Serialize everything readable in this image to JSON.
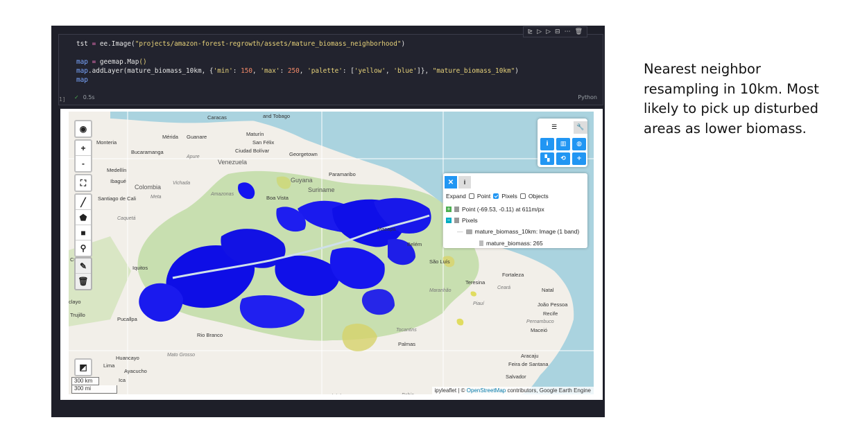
{
  "cell": {
    "toolbar_icons": [
      "run-by-line-icon",
      "run-above-icon",
      "run-below-icon",
      "split-cell-icon",
      "more-icon",
      "delete-icon"
    ],
    "toolbar_glyphs": [
      "⊵",
      "▷",
      "▷",
      "⊟",
      "⋯",
      "🗑"
    ],
    "code_lines": [
      {
        "parts": [
          [
            "",
            "tst "
          ],
          [
            "pink",
            "="
          ],
          [
            "",
            " ee.Image("
          ],
          [
            "str",
            "\"projects/amazon-forest-regrowth/assets/mature_biomass_neighborhood\""
          ],
          [
            "",
            ")"
          ]
        ]
      },
      {
        "parts": []
      },
      {
        "parts": [
          [
            "kw-var",
            "map"
          ],
          [
            "",
            " "
          ],
          [
            "pink",
            "="
          ],
          [
            "",
            " geemap.Map"
          ],
          [
            "str",
            "()"
          ]
        ]
      },
      {
        "parts": [
          [
            "kw-var",
            "map"
          ],
          [
            "",
            ".addLayer(mature_biomass_10km, {"
          ],
          [
            "str",
            "'min'"
          ],
          [
            "",
            ": "
          ],
          [
            "num",
            "150"
          ],
          [
            "",
            ", "
          ],
          [
            "str",
            "'max'"
          ],
          [
            "",
            ": "
          ],
          [
            "num",
            "250"
          ],
          [
            "",
            ", "
          ],
          [
            "str",
            "'palette'"
          ],
          [
            "",
            ": ["
          ],
          [
            "str",
            "'yellow'"
          ],
          [
            "",
            ", "
          ],
          [
            "str",
            "'blue'"
          ],
          [
            "",
            "]}, "
          ],
          [
            "str",
            "\"mature_biomass_10km\""
          ],
          [
            "",
            ")"
          ]
        ]
      },
      {
        "parts": [
          [
            "kw-var",
            "map"
          ]
        ]
      }
    ],
    "exec_count": "1]",
    "duration": "0.5s",
    "language": "Python"
  },
  "map": {
    "labels": [
      {
        "text": "Caracas",
        "cls": ""
      },
      {
        "text": "and Tobago",
        "cls": ""
      },
      {
        "text": "Mérida",
        "cls": ""
      },
      {
        "text": "Guanare",
        "cls": ""
      },
      {
        "text": "Maturín",
        "cls": ""
      },
      {
        "text": "San Félix",
        "cls": ""
      },
      {
        "text": "Monteria",
        "cls": ""
      },
      {
        "text": "Ciudad Bolívar",
        "cls": ""
      },
      {
        "text": "Bucaramanga",
        "cls": ""
      },
      {
        "text": "Apure",
        "cls": "region"
      },
      {
        "text": "Venezuela",
        "cls": "big"
      },
      {
        "text": "Georgetown",
        "cls": ""
      },
      {
        "text": "Medellín",
        "cls": ""
      },
      {
        "text": "Ibagué",
        "cls": ""
      },
      {
        "text": "Vichada",
        "cls": "region"
      },
      {
        "text": "Colombia",
        "cls": "big"
      },
      {
        "text": "Guyana",
        "cls": "big"
      },
      {
        "text": "Paramaribo",
        "cls": ""
      },
      {
        "text": "Suriname",
        "cls": "big"
      },
      {
        "text": "Santiago de Cali",
        "cls": ""
      },
      {
        "text": "Meta",
        "cls": "region"
      },
      {
        "text": "Amazonas",
        "cls": "region"
      },
      {
        "text": "Boa Vista",
        "cls": ""
      },
      {
        "text": "Caquetá",
        "cls": "region"
      },
      {
        "text": "Macapá",
        "cls": ""
      },
      {
        "text": "Belém",
        "cls": ""
      },
      {
        "text": "Cuenca",
        "cls": ""
      },
      {
        "text": "Iquitos",
        "cls": ""
      },
      {
        "text": "São Luís",
        "cls": ""
      },
      {
        "text": "Fortaleza",
        "cls": ""
      },
      {
        "text": "Teresina",
        "cls": ""
      },
      {
        "text": "Maranhão",
        "cls": "region"
      },
      {
        "text": "Ceará",
        "cls": "region"
      },
      {
        "text": "Natal",
        "cls": ""
      },
      {
        "text": "Piauí",
        "cls": "region"
      },
      {
        "text": "João Pessoa",
        "cls": ""
      },
      {
        "text": "Recife",
        "cls": ""
      },
      {
        "text": "Pernambuco",
        "cls": "region"
      },
      {
        "text": "Trujillo",
        "cls": ""
      },
      {
        "text": "Pucallpa",
        "cls": ""
      },
      {
        "text": "Maceió",
        "cls": ""
      },
      {
        "text": "Palmas",
        "cls": ""
      },
      {
        "text": "Tocantins",
        "cls": "region"
      },
      {
        "text": "Rio Branco",
        "cls": ""
      },
      {
        "text": "Huancayo",
        "cls": ""
      },
      {
        "text": "Lima",
        "cls": ""
      },
      {
        "text": "Ayacucho",
        "cls": ""
      },
      {
        "text": "Mato Grosso",
        "cls": "region"
      },
      {
        "text": "Aracaju",
        "cls": ""
      },
      {
        "text": "Feira de Santana",
        "cls": ""
      },
      {
        "text": "Salvador",
        "cls": ""
      },
      {
        "text": "Ica",
        "cls": ""
      },
      {
        "text": "Cuiabá",
        "cls": ""
      },
      {
        "text": "Bahia",
        "cls": "region"
      },
      {
        "text": "clayo",
        "cls": ""
      },
      {
        "text": "Amazonas",
        "cls": "region"
      }
    ],
    "scale_km": "300 km",
    "scale_mi": "300 mi",
    "attribution_prefix": "ipyleaflet | ©",
    "attribution_link": "OpenStreetMap",
    "attribution_suffix": "contributors, Google Earth Engine"
  },
  "toolbox": {
    "tabs": [
      "layers-icon",
      "wrench-icon"
    ],
    "buttons": [
      {
        "name": "inspector-tool-button",
        "glyph": "i"
      },
      {
        "name": "plotting-tool-button",
        "glyph": "▥"
      },
      {
        "name": "basemap-tool-button",
        "glyph": "◍"
      },
      {
        "name": "split-map-tool-button",
        "glyph": "▚"
      },
      {
        "name": "reset-tool-button",
        "glyph": "⟲"
      },
      {
        "name": "more-tools-button",
        "glyph": "+"
      }
    ]
  },
  "inspector": {
    "close_glyph": "✕",
    "info_glyph": "i",
    "expand_label": "Expand",
    "point_label": "Point",
    "pixels_label": "Pixels",
    "objects_label": "Objects",
    "point_checked": false,
    "pixels_checked": true,
    "objects_checked": false,
    "point_row": "Point (-69.53, -0.11) at 611m/px",
    "pixels_row": "Pixels",
    "layer_row": "mature_biomass_10km: Image (1 band)",
    "value_row": "mature_biomass: 265"
  },
  "left_controls": {
    "globe": "◉",
    "zoom_in": "+",
    "zoom_out": "-",
    "fullscreen": "⛶",
    "draw_line": "╱",
    "draw_polygon": "⬟",
    "draw_rect": "■",
    "draw_marker": "⚲",
    "edit": "✎",
    "delete": "🗑",
    "layer_toggle": "◩"
  },
  "note": {
    "text": "Nearest neighbor resampling in 10km. Most likely to pick up disturbed areas as lower biomass."
  },
  "colors": {
    "biomass_high": "#0000ff",
    "biomass_low": "#e8e85a",
    "water": "#aad3df",
    "land": "#f2efe9",
    "accent": "#2196f3"
  }
}
